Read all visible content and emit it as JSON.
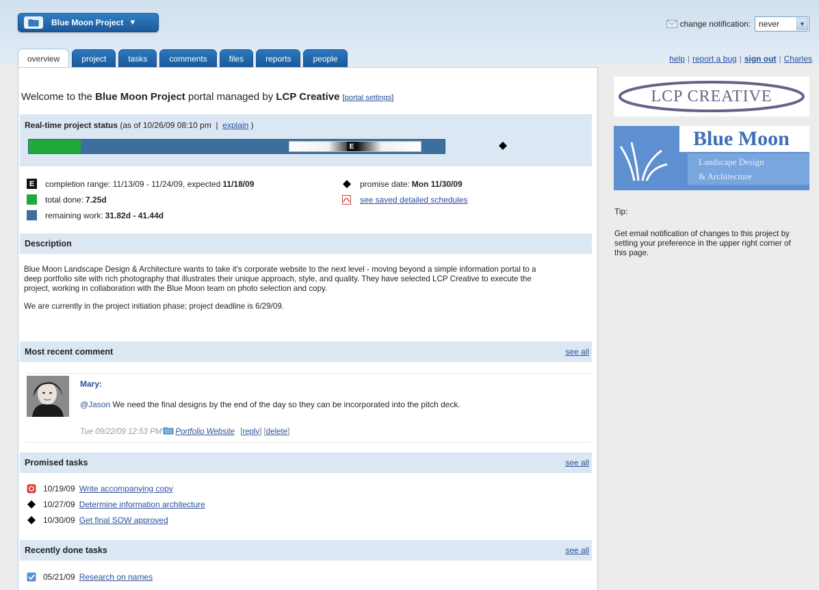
{
  "project_button": {
    "label": "Blue Moon Project"
  },
  "notification": {
    "label": "change notification:",
    "value": "never"
  },
  "tabs": [
    {
      "label": "overview"
    },
    {
      "label": "project"
    },
    {
      "label": "tasks"
    },
    {
      "label": "comments"
    },
    {
      "label": "files"
    },
    {
      "label": "reports"
    },
    {
      "label": "people"
    }
  ],
  "top_links": {
    "help": "help",
    "report_bug": "report a bug",
    "sign_out": "sign out",
    "user": "Charles"
  },
  "welcome": {
    "prefix": "Welcome to the ",
    "project": "Blue Moon Project",
    "middle": " portal managed by ",
    "company": "LCP Creative",
    "settings_link": "portal settings"
  },
  "status": {
    "title": "Real-time project status",
    "as_of_prefix": "(as of ",
    "as_of": "10/26/09 08:10 pm",
    "explain": "explain",
    "done_fraction": 0.125,
    "marker_label": "E",
    "completion_label": "completion range: 11/13/09 - 11/24/09, expected ",
    "completion_expected": "11/18/09",
    "total_done_label": "total done: ",
    "total_done": "7.25d",
    "remaining_label": "remaining work: ",
    "remaining": "31.82d - 41.44d",
    "promise_label": "promise date: ",
    "promise_date": "Mon 11/30/09",
    "schedules_link": "see saved detailed schedules",
    "colors": {
      "done": "#1faa3a",
      "remaining": "#3d6f9e"
    }
  },
  "description": {
    "title": "Description",
    "para1": "Blue Moon Landscape Design & Architecture wants to take it's corporate website to the next level - moving beyond a simple information portal to a deep portfolio site with rich photography that illustrates their unique approach, style, and quality. They have selected LCP Creative to execute the project, working in collaboration with the Blue Moon team on photo selection and copy.",
    "para2": "We are currently in the project initiation phase; project deadline is 6/29/09."
  },
  "comment": {
    "title": "Most recent comment",
    "see_all": "see all",
    "author": "Mary:",
    "mention": "@Jason",
    "body": " We need the final designs by the end of the day so they can be incorporated into the pitch deck.",
    "timestamp": "Tue 09/22/09 12:53 PM",
    "project_link": "Portfolio Website",
    "reply": "reply",
    "delete": "delete"
  },
  "promised_tasks": {
    "title": "Promised tasks",
    "see_all": "see all",
    "items": [
      {
        "date": "10/19/09",
        "name": "Write accompanying copy",
        "icon": "overdue-alert-icon"
      },
      {
        "date": "10/27/09",
        "name": "Determine information architecture",
        "icon": "diamond-icon"
      },
      {
        "date": "10/30/09",
        "name": "Get final SOW approved",
        "icon": "diamond-icon"
      }
    ]
  },
  "recent_tasks": {
    "title": "Recently done tasks",
    "see_all": "see all",
    "items": [
      {
        "date": "05/21/09",
        "name": "Research on names"
      }
    ]
  },
  "sidebar": {
    "lcp_logo": "LCP CREATIVE",
    "client_logo": {
      "title": "Blue Moon",
      "line1": "Landscape Design",
      "line2": "& Architecture"
    },
    "tip_label": "Tip:",
    "tip_text": "Get email notification of changes to this project by setting your preference in the upper right corner of this page."
  }
}
